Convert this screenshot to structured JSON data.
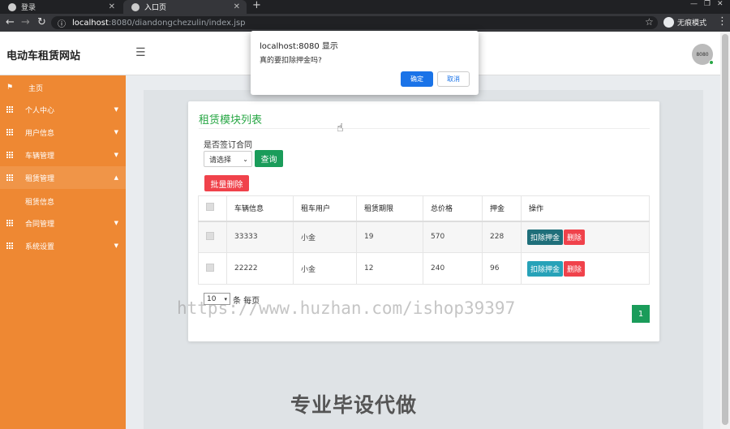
{
  "browser": {
    "tabs": [
      {
        "label": "登录",
        "active": false
      },
      {
        "label": "入口页",
        "active": true
      }
    ],
    "url_host": "localhost",
    "url_rest": ":8080/diandongchezulin/index.jsp",
    "incognito_label": "无痕模式"
  },
  "header": {
    "brand": "电动车租赁网站",
    "avatar_text": "8080"
  },
  "sidebar": {
    "items": [
      {
        "label": "主页",
        "icon": "flag-icon",
        "caret": ""
      },
      {
        "label": "个人中心",
        "icon": "grid-icon",
        "caret": "▼"
      },
      {
        "label": "用户信息",
        "icon": "grid-icon",
        "caret": "▼"
      },
      {
        "label": "车辆管理",
        "icon": "grid-icon",
        "caret": "▼"
      },
      {
        "label": "租赁管理",
        "icon": "grid-icon",
        "caret": "▲"
      },
      {
        "label": "合同管理",
        "icon": "grid-icon",
        "caret": "▼"
      },
      {
        "label": "系统设置",
        "icon": "grid-icon",
        "caret": "▼"
      }
    ],
    "subitem": "租赁信息"
  },
  "main": {
    "title": "租赁模块列表",
    "filter_label": "是否签订合同",
    "filter_value": "请选择",
    "query_button": "查询",
    "batch_delete_button": "批量删除",
    "columns": [
      "车辆信息",
      "租车用户",
      "租赁期限",
      "总价格",
      "押金",
      "操作"
    ],
    "rows": [
      {
        "vehicle": "33333",
        "user": "小金",
        "term": "19",
        "total": "570",
        "deposit": "228"
      },
      {
        "vehicle": "22222",
        "user": "小金",
        "term": "12",
        "total": "240",
        "deposit": "96"
      }
    ],
    "deduct_label": "扣除押金",
    "delete_label": "删除",
    "page_size": "10",
    "page_size_label": "条 每页",
    "current_page": "1"
  },
  "colors": {
    "sidebar": "#ee8833",
    "accent_green": "#1a9c5a",
    "danger": "#f0424b",
    "deduct_row1": "#1f6f7a",
    "deduct_row2": "#27a2b8"
  },
  "watermark": "https://www.huzhan.com/ishop39397",
  "promo": "专业毕设代做",
  "dialog": {
    "title": "localhost:8080 显示",
    "message": "真的要扣除押金吗?",
    "ok": "确定",
    "cancel": "取消"
  }
}
